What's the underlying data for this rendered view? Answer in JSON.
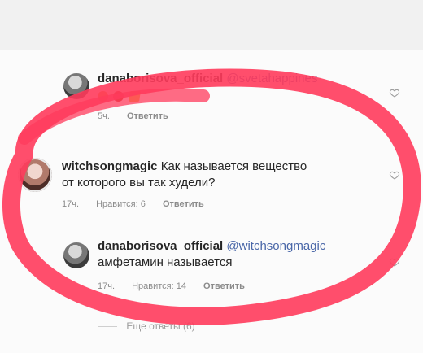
{
  "comments": [
    {
      "username": "danaborisova_official",
      "mention": "@svetahappines",
      "meta": {
        "time": "5ч.",
        "reply": "Ответить"
      }
    },
    {
      "username": "witchsongmagic",
      "text_line1": "Как называется вещество",
      "text_line2": "от которого вы так худели?",
      "meta": {
        "time": "17ч.",
        "likes": "Нравится: 6",
        "reply": "Ответить"
      }
    },
    {
      "username": "danaborisova_official",
      "mention": "@witchsongmagic",
      "text_line2": "амфетамин называется",
      "meta": {
        "time": "17ч.",
        "likes": "Нравится: 14",
        "reply": "Ответить"
      }
    }
  ],
  "view_more_replies": "Еще ответы (6)",
  "colors": {
    "username": "#262626",
    "mention": "#4a67a8",
    "muted": "#8b8b8b",
    "scribble": "#ff3b5c"
  },
  "icons": {
    "heart": "heart-icon",
    "avatar": "avatar"
  }
}
